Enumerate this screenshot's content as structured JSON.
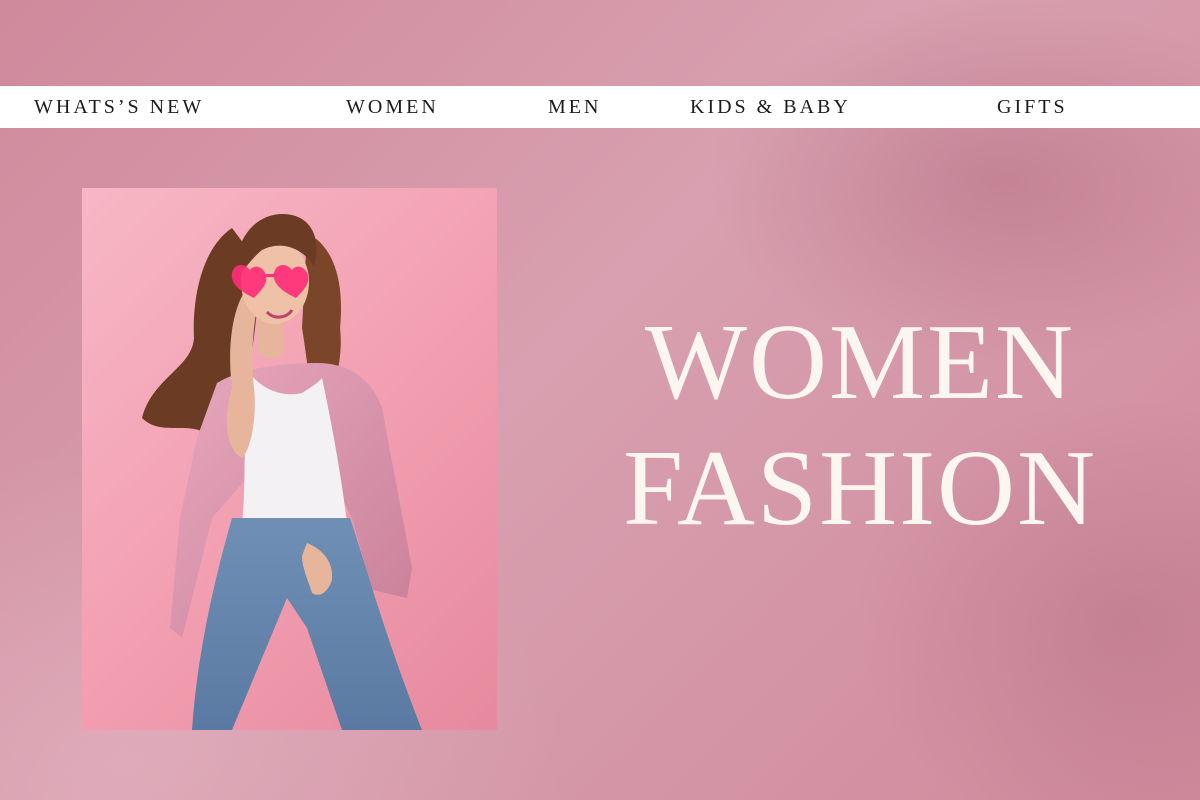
{
  "nav": {
    "items": [
      {
        "id": "whats-new",
        "label": "WHATS’S NEW"
      },
      {
        "id": "women",
        "label": "WOMEN"
      },
      {
        "id": "men",
        "label": "MEN"
      },
      {
        "id": "kids-baby",
        "label": "KIDS & BABY"
      },
      {
        "id": "gifts",
        "label": "GIFTS"
      }
    ]
  },
  "hero": {
    "headline_line1": "WOMEN",
    "headline_line2": "FASHION",
    "photo": {
      "subject": "woman-in-pink-jacket"
    }
  },
  "colors": {
    "background": "#d38ea0",
    "nav_bar": "#ffffff",
    "nav_text": "#1c1c1c",
    "headline": "#fbf6ef",
    "photo_backdrop": "#f29eb0"
  }
}
